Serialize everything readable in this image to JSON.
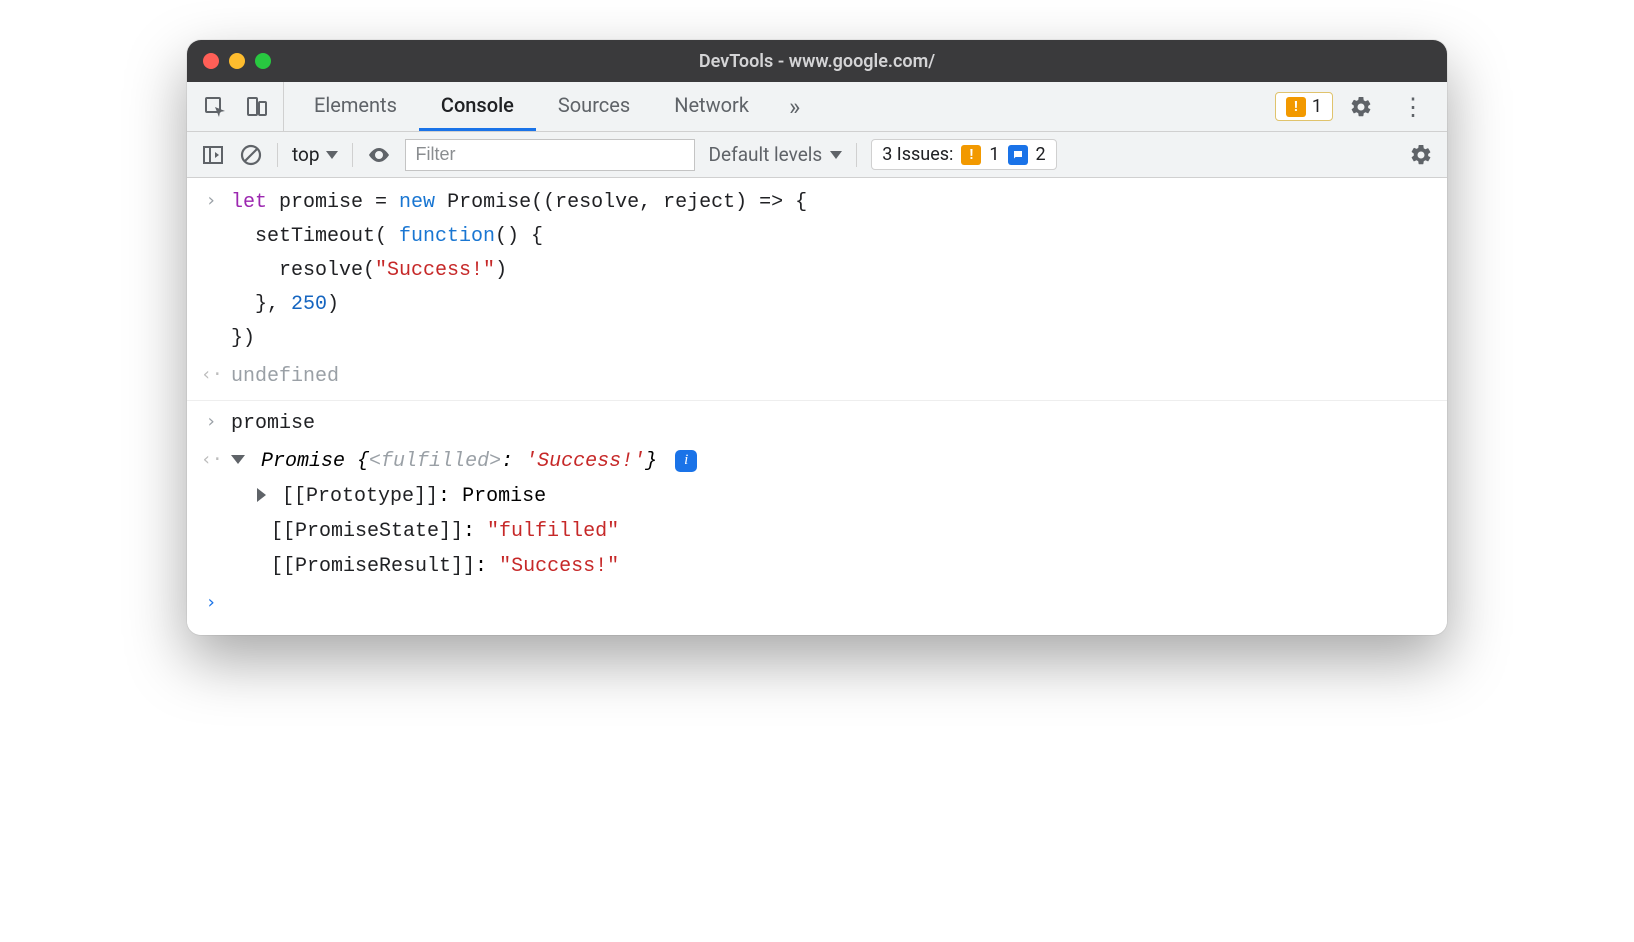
{
  "window": {
    "title": "DevTools - www.google.com/"
  },
  "tabs": {
    "items": [
      "Elements",
      "Console",
      "Sources",
      "Network"
    ],
    "active_index": 1,
    "more_glyph": "»"
  },
  "tabstrip_badge": {
    "warn_count": "1"
  },
  "toolbar": {
    "context": "top",
    "filter_placeholder": "Filter",
    "levels_label": "Default levels",
    "issues_label": "3 Issues:",
    "issues_warn": "1",
    "issues_msg": "2"
  },
  "console": {
    "input1": {
      "l1_decl": "let",
      "l1_rest": " promise = ",
      "l1_new": "new",
      "l1_ctor": " Promise((resolve, reject) => {",
      "l2a": "  setTimeout( ",
      "l2_func": "function",
      "l2b": "() {",
      "l3a": "    resolve(",
      "l3_str": "\"Success!\"",
      "l3b": ")",
      "l4a": "  }, ",
      "l4_num": "250",
      "l4b": ")",
      "l5": "})"
    },
    "result1": "undefined",
    "input2": "promise",
    "result2": {
      "summary_class": "Promise",
      "summary_open": " {",
      "summary_state": "<fulfilled>",
      "summary_colon": ": ",
      "summary_value": "'Success!'",
      "summary_close": "}",
      "p1_key": "[[Prototype]]",
      "p1_val": "Promise",
      "p2_key": "[[PromiseState]]",
      "p2_val": "\"fulfilled\"",
      "p3_key": "[[PromiseResult]]",
      "p3_val": "\"Success!\""
    }
  }
}
